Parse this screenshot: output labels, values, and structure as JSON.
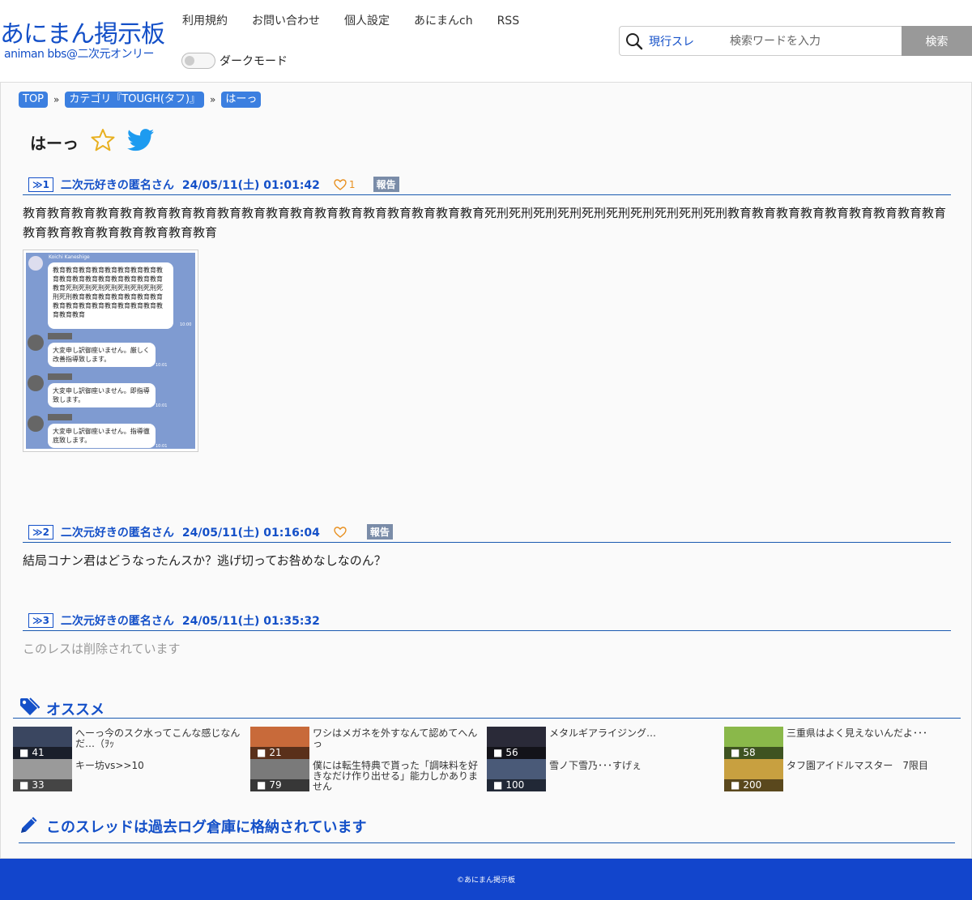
{
  "header": {
    "logo_main": "あにまん掲示板",
    "logo_sub": "animan bbs@二次元オンリー",
    "nav": [
      "利用規約",
      "お問い合わせ",
      "個人設定",
      "あにまんch",
      "RSS"
    ],
    "darkmode_label": "ダークモード",
    "search_scope": "現行スレ",
    "search_placeholder": "検索ワードを入力",
    "search_button": "検索"
  },
  "breadcrumb": [
    "TOP",
    "カテゴリ『TOUGH(タフ)』",
    "はーっ"
  ],
  "breadcrumb_sep": "»",
  "thread": {
    "title": "はーっ"
  },
  "posts": [
    {
      "num": "≫1",
      "author": "二次元好きの匿名さん",
      "date": "24/05/11(土) 01:01:42",
      "likes": "1",
      "report": "報告",
      "body": "教育教育教育教育教育教育教育教育教育教育教育教育教育教育教育教育教育教育教育死刑死刑死刑死刑死刑死刑死刑死刑死刑死刑教育教育教育教育教育教育教育教育教育教育教育教育教育教育教育教育教育"
    },
    {
      "num": "≫2",
      "author": "二次元好きの匿名さん",
      "date": "24/05/11(土) 01:16:04",
      "likes": "",
      "report": "報告",
      "body": "結局コナン君はどうなったんスか？逃げ切ってお咎めなしなのん？"
    },
    {
      "num": "≫3",
      "author": "二次元好きの匿名さん",
      "date": "24/05/11(土) 01:35:32",
      "body": "このレスは削除されています"
    }
  ],
  "image_chat": {
    "name": "Koichi Kaneshige",
    "bubble1": "教育教育教育教育教育教育教育教育教育教育教育教育教育教育教育教育教育教育死刑死刑死刑死刑死刑死刑死刑死刑死刑教育教育教育教育教育教育教育教育教育教育教育教育教育教育教育教育教育教育",
    "time1": "10:00",
    "bubble2": "大変申し訳御座いません。厳しく改善指導致します。",
    "time2": "10:01",
    "bubble3": "大変申し訳御座いません。即指導致します。",
    "time3": "10:01",
    "bubble4": "大変申し訳御座いません。指導徹底致します。",
    "time4": "10:01"
  },
  "recommend": {
    "title": "オススメ",
    "items": [
      {
        "title": "へーっ今のスク水ってこんな感じなんだ…（ｦｯ",
        "count": "41",
        "color": "#3a4660"
      },
      {
        "title": "ワシはメガネを外すなんて認めてへんっ",
        "count": "21",
        "color": "#c86a3a"
      },
      {
        "title": "メタルギアライジング…",
        "count": "56",
        "color": "#2a2a38"
      },
      {
        "title": "三重県はよく見えないんだよ･･･",
        "count": "58",
        "color": "#8ab84a"
      },
      {
        "title": "キー坊vs>>10",
        "count": "33",
        "color": "#9a9a9a"
      },
      {
        "title": "僕には転生特典で貰った「調味料を好きなだけ作り出せる」能力しかありません",
        "count": "79",
        "color": "#7a7a7a"
      },
      {
        "title": "雪ノ下雪乃･･･すげぇ",
        "count": "100",
        "color": "#4a5a78"
      },
      {
        "title": "タフ園アイドルマスター　7限目",
        "count": "200",
        "color": "#c8a040"
      }
    ]
  },
  "archive": {
    "title": "このスレッドは過去ログ倉庫に格納されています"
  },
  "footer": {
    "copyright": "©あにまん掲示板"
  }
}
